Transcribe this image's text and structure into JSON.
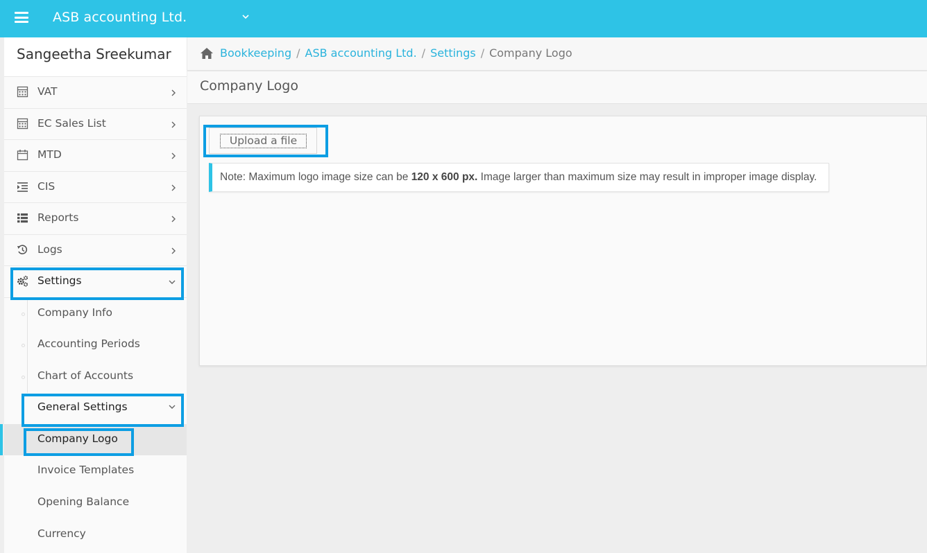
{
  "header": {
    "company_name": "ASB accounting Ltd.",
    "menu_icon": "hamburger-icon",
    "brand_color": "#2ec3e6"
  },
  "sidebar": {
    "user_name": "Sangeetha Sreekumar",
    "items": [
      {
        "label": "VAT",
        "icon": "calculator-icon"
      },
      {
        "label": "EC Sales List",
        "icon": "calculator-icon"
      },
      {
        "label": "MTD",
        "icon": "calendar-icon"
      },
      {
        "label": "CIS",
        "icon": "indent-list-icon"
      },
      {
        "label": "Reports",
        "icon": "list-icon"
      },
      {
        "label": "Logs",
        "icon": "history-icon"
      },
      {
        "label": "Settings",
        "icon": "gears-icon"
      }
    ],
    "settings_children": [
      {
        "label": "Company Info"
      },
      {
        "label": "Accounting Periods"
      },
      {
        "label": "Chart of Accounts"
      },
      {
        "label": "General Settings"
      },
      {
        "label": "Company Logo"
      },
      {
        "label": "Invoice Templates"
      },
      {
        "label": "Opening Balance"
      },
      {
        "label": "Currency"
      }
    ],
    "active_item": "Company Logo"
  },
  "breadcrumb": {
    "items": [
      "Bookkeeping",
      "ASB accounting Ltd.",
      "Settings"
    ],
    "current": "Company Logo",
    "separator": "/"
  },
  "page": {
    "title": "Company Logo",
    "upload_label": "Upload a file",
    "note_prefix": "Note: Maximum logo image size can be ",
    "note_size": "120 x 600 px.",
    "note_suffix": " Image larger than maximum size may result in improper image display."
  },
  "colors": {
    "highlight": "#0d9ee3",
    "link": "#2ab3dc"
  }
}
